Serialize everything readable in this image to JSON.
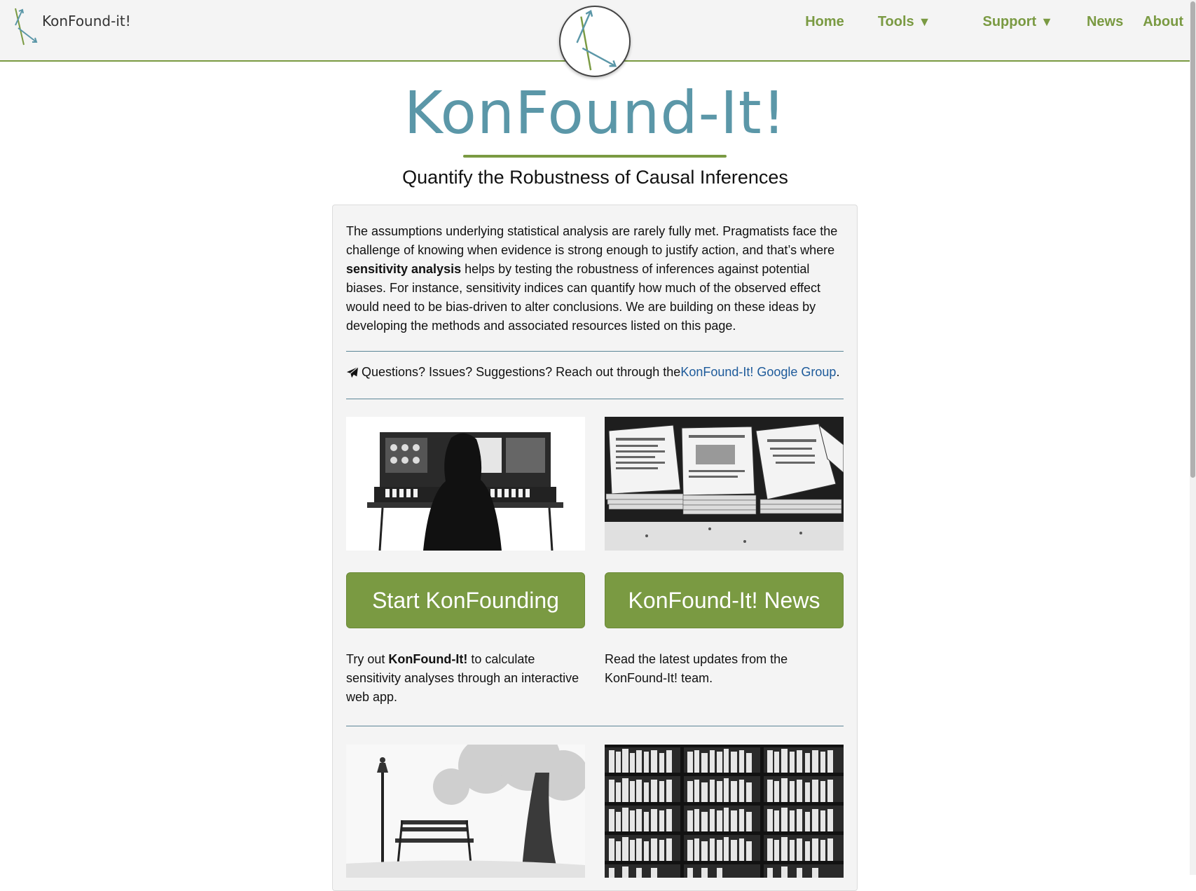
{
  "nav": {
    "brand": "KonFound-it!",
    "links": [
      {
        "label": "Home"
      },
      {
        "label": "Tools",
        "caret": "▼"
      },
      {
        "label": "Support",
        "caret": "▼"
      },
      {
        "label": "News"
      },
      {
        "label": "About"
      }
    ]
  },
  "hero": {
    "title": "KonFound-It!",
    "subtitle": "Quantify the Robustness of Causal Inferences"
  },
  "intro": {
    "part1": "The assumptions underlying statistical analysis are rarely fully met. Pragmatists face the challenge of knowing when evidence is strong enough to justify action, and that’s where ",
    "bold": "sensitivity analysis",
    "part2": " helps by testing the robustness of inferences against potential biases. For instance, sensitivity indices can quantify how much of the observed effect would need to be bias-driven to alter conclusions. We are building on these ideas by developing the methods and associated resources listed on this page."
  },
  "contact": {
    "icon": "paper-plane-icon",
    "text": "Questions? Issues? Suggestions? Reach out through the ",
    "link": "KonFound-It! Google Group",
    "suffix": "."
  },
  "cards": [
    {
      "image": "person at vintage synthesizer illustration",
      "button": "Start KonFounding",
      "desc_pre": "Try out ",
      "desc_bold": "KonFound-It!",
      "desc_post": " to calculate sensitivity analyses through an interactive web app."
    },
    {
      "image": "stacks of newspapers illustration",
      "button": "KonFound-It! News",
      "desc": "Read the latest updates from the KonFound-It! team."
    },
    {
      "image": "park bench with lamppost illustration"
    },
    {
      "image": "library bookshelves illustration"
    }
  ],
  "colors": {
    "accent_green": "#7a9a42",
    "title_teal": "#5b97a8",
    "link_blue": "#1d5a9a",
    "card_bg": "#f4f4f4"
  }
}
